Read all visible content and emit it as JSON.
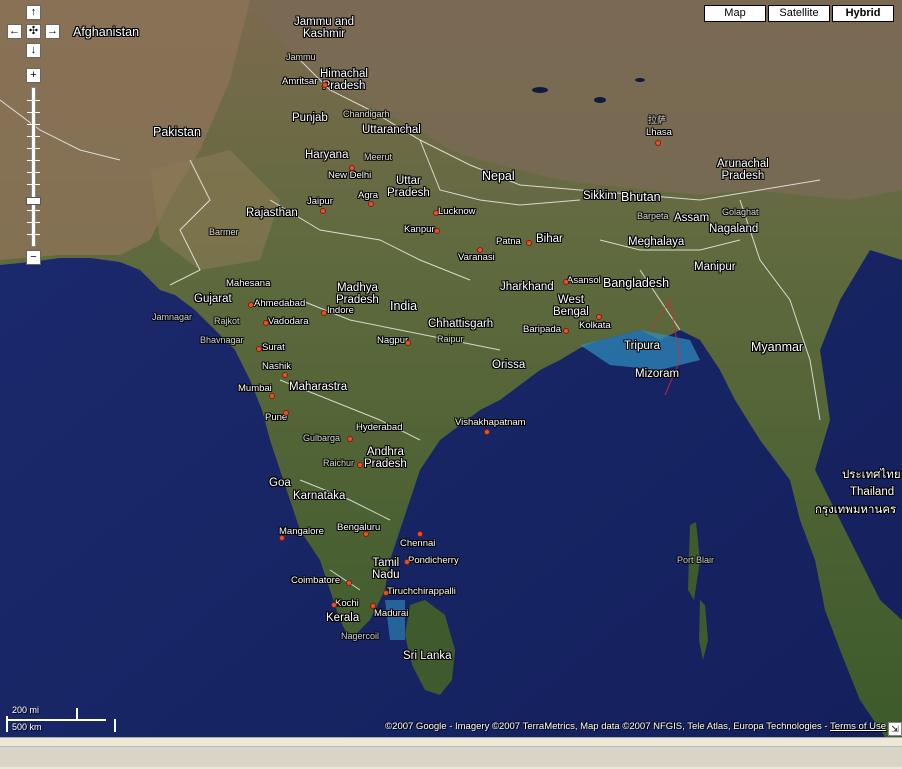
{
  "controls": {
    "pan_up": "↑",
    "pan_left": "←",
    "pan_center": "✣",
    "pan_right": "→",
    "pan_down": "↓",
    "zoom_in": "+",
    "zoom_out": "−"
  },
  "map_types": {
    "map": "Map",
    "satellite": "Satellite",
    "hybrid": "Hybrid",
    "selected": "Hybrid"
  },
  "scale": {
    "miles": "200 mi",
    "km": "500 km"
  },
  "copyright": {
    "text": "©2007 Google - Imagery ©2007 TerraMetrics, Map data ©2007 NFGIS, Tele Atlas, Europa Technologies - ",
    "terms": "Terms of Use"
  },
  "labels": {
    "afghanistan": "Afghanistan",
    "pakistan": "Pakistan",
    "jammu": "Jammu and\nKashmir",
    "jammu_city": "Jammu",
    "amritsar": "Amritsar",
    "himachal": "Himachal\nPradesh",
    "punjab": "Punjab",
    "chandigarh": "Chandigarh",
    "uttaranchal": "Uttaranchal",
    "haryana": "Haryana",
    "meerut": "Meerut",
    "new_delhi": "New Delhi",
    "agra": "Agra",
    "uttar_pradesh": "Uttar\nPradesh",
    "rajasthan": "Rajasthan",
    "jaipur": "Jaipur",
    "lucknow": "Lucknow",
    "kanpur": "Kanpur",
    "barmer": "Barmer",
    "nepal": "Nepal",
    "lhasa": "Lhasa",
    "lhasa_native": "拉萨",
    "sikkim": "Sikkim",
    "bhutan": "Bhutan",
    "arunachal": "Arunachal\nPradesh",
    "assam": "Assam",
    "barpeta": "Barpeta",
    "golaghat": "Golaghat",
    "nagaland": "Nagaland",
    "meghalaya": "Meghalaya",
    "patna": "Patna",
    "bihar": "Bihar",
    "varanasi": "Varanasi",
    "manipur": "Manipur",
    "mahesana": "Mahesana",
    "gujarat": "Gujarat",
    "ahmedabad": "Ahmedabad",
    "madhya_pradesh": "Madhya\nPradesh",
    "india": "India",
    "jharkhand": "Jharkhand",
    "asansol": "Asansol",
    "bangladesh": "Bangladesh",
    "jamnagar": "Jamnagar",
    "rajkot": "Rajkot",
    "vadodara": "Vadodara",
    "indore": "Indore",
    "west_bengal": "West\nBengal",
    "bhavnagar": "Bhavnagar",
    "chhattisgarh": "Chhattisgarh",
    "baripada": "Baripada",
    "kolkata": "Kolkata",
    "surat": "Surat",
    "nagpur": "Nagpur",
    "raipur": "Raipur",
    "tripura": "Tripura",
    "myanmar": "Myanmar",
    "nashik": "Nashik",
    "orissa": "Orissa",
    "mizoram": "Mizoram",
    "mumbai": "Mumbai",
    "maharastra": "Maharastra",
    "pune": "Pune",
    "visakhapatnam": "Vishakhapatnam",
    "hyderabad": "Hyderabad",
    "gulbarga": "Gulbarga",
    "raichur": "Raichur",
    "andhra": "Andhra\nPradesh",
    "thailand_native": "ประเทศไทย",
    "thailand": "Thailand",
    "bangkok_native": "กรุงเทพมหานคร",
    "goa": "Goa",
    "karnataka": "Karnataka",
    "mangalore": "Mangalore",
    "bengaluru": "Bengaluru",
    "chennai": "Chennai",
    "port_blair": "Port Blair",
    "pondicherry": "Pondicherry",
    "tamil_nadu": "Tamil\nNadu",
    "coimbatore": "Coimbatore",
    "tiruchirappalli": "Tiruchchirappalli",
    "kochi": "Kochi",
    "kerala": "Kerala",
    "madurai": "Madurai",
    "nagercoil": "Nagercoil",
    "sri_lanka": "Sri Lanka"
  }
}
